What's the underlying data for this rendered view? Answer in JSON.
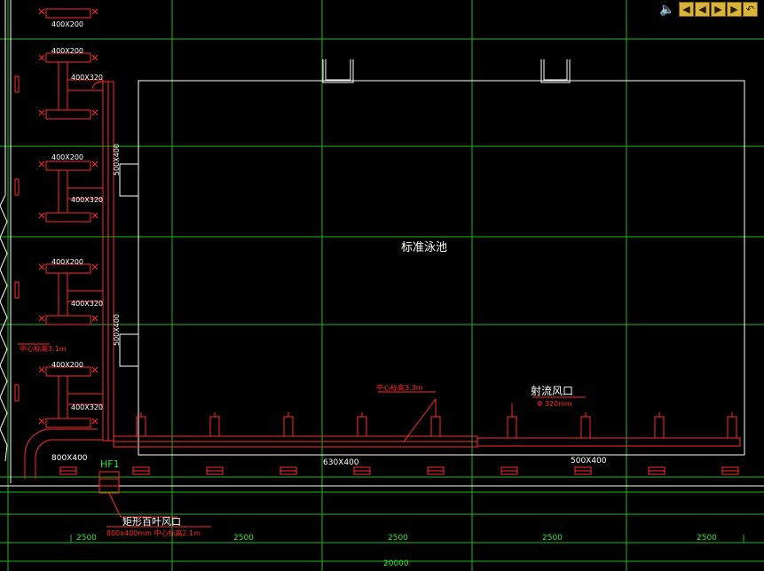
{
  "drawing": {
    "pool_label": "标准泳池",
    "outlet_label": "射流风口",
    "outlet_spec": "Φ 320mm",
    "center_height_main": "中心标高3.3m",
    "center_height_left": "中心标高3.1m",
    "louver_label": "矩形百叶风口",
    "louver_spec": "800x400mm 中心标高2.1m",
    "hf_label": "HF1",
    "duct_sizes": {
      "d_800x400": "800X400",
      "d_630x400": "630X400",
      "d_500x400": "500X400",
      "d_400x200_a": "400X200",
      "d_400x200_b": "400X200",
      "d_400x200_c": "400X200",
      "d_400x200_d": "400X200",
      "d_400x200_e": "400X200",
      "d_400x320_a": "400X320",
      "d_400x320_b": "400X320",
      "d_400x320_c": "400X320",
      "d_400x320_d": "400X320",
      "d_vert_a": "500X400",
      "d_vert_b": "500X400"
    },
    "dimensions": {
      "dim1": "2500",
      "dim2": "2500",
      "dim3": "2500",
      "dim4": "2500",
      "dim5": "2500",
      "total": "20000"
    },
    "colors": {
      "duct": "#ff2a2a",
      "grid": "#20c020",
      "wall": "#ffffff",
      "text_green": "#36e336",
      "background": "#000000"
    }
  },
  "toolbar": {
    "speaker_icon": "speaker-icon",
    "buttons": [
      "first-icon",
      "prev-icon",
      "next-icon",
      "last-icon",
      "return-icon"
    ]
  }
}
